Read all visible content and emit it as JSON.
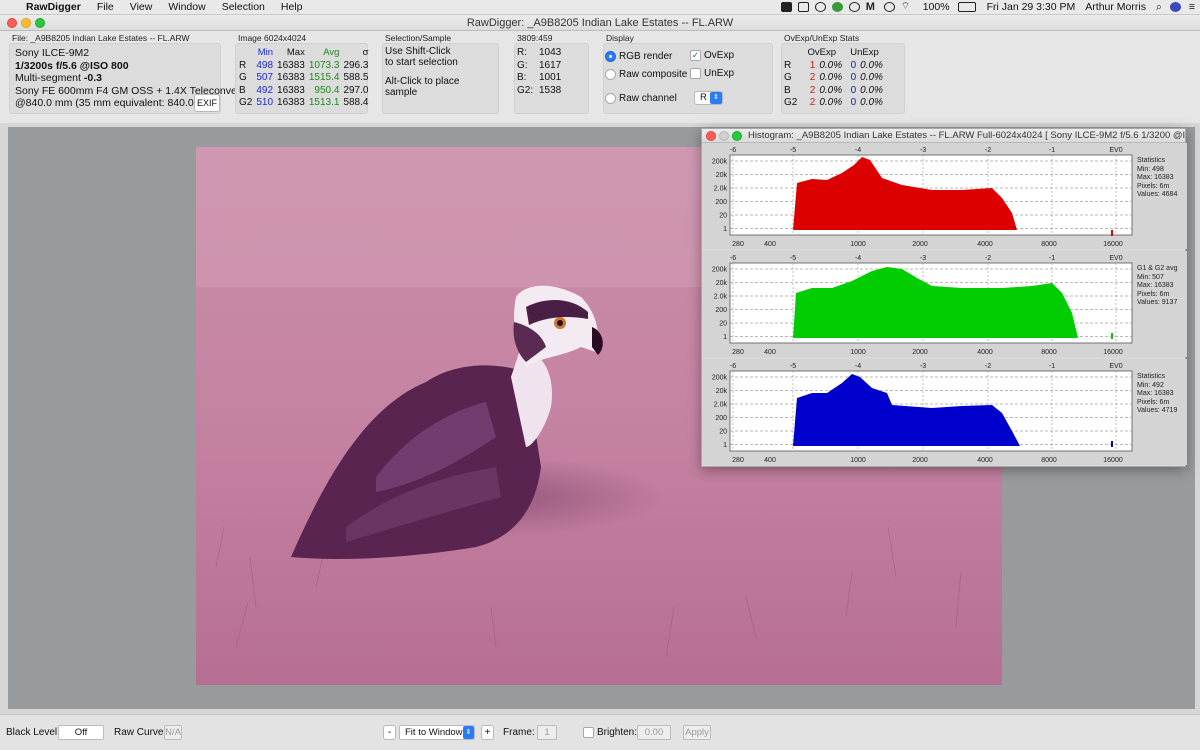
{
  "menubar": {
    "app": "RawDigger",
    "items": [
      "File",
      "View",
      "Window",
      "Selection",
      "Help"
    ],
    "battery": "100%",
    "datetime": "Fri Jan 29  3:30 PM",
    "user": "Arthur Morris"
  },
  "window": {
    "title": "RawDigger: _A9B8205  Indian Lake Estates -- FL.ARW"
  },
  "file_panel": {
    "label": "File: _A9B8205  Indian Lake Estates -- FL.ARW",
    "camera": "Sony ILCE-9M2",
    "exposure": "1/3200s f/5.6 @ISO 800",
    "segment_prefix": "Multi-segment",
    "segment_value": "-0.3",
    "lens": "Sony FE 600mm F4 GM OSS + 1.4X Teleconverter",
    "focal": "@840.0 mm (35 mm equivalent: 840.0 mm)",
    "exif_button": "EXIF"
  },
  "image_stats": {
    "label": "Image 6024x4024",
    "headers": [
      "Min",
      "Max",
      "Avg",
      "σ"
    ],
    "rows": [
      {
        "ch": "R",
        "min": "498",
        "max": "16383",
        "avg": "1073.3",
        "sd": "296.3"
      },
      {
        "ch": "G",
        "min": "507",
        "max": "16383",
        "avg": "1515.4",
        "sd": "588.5"
      },
      {
        "ch": "B",
        "min": "492",
        "max": "16383",
        "avg": "950.4",
        "sd": "297.0"
      },
      {
        "ch": "G2",
        "min": "510",
        "max": "16383",
        "avg": "1513.1",
        "sd": "588.4"
      }
    ]
  },
  "selection": {
    "label": "Selection/Sample",
    "line1": "Use Shift-Click",
    "line2": "to start selection",
    "line3": "Alt-Click to place",
    "line4": "sample"
  },
  "sample": {
    "label": "3809:459",
    "rows": [
      {
        "ch": "R:",
        "val": "1043"
      },
      {
        "ch": "G:",
        "val": "1617"
      },
      {
        "ch": "B:",
        "val": "1001"
      },
      {
        "ch": "G2:",
        "val": "1538"
      }
    ]
  },
  "display": {
    "label": "Display",
    "rgb_render": "RGB render",
    "raw_composite": "Raw composite",
    "raw_channel": "Raw channel",
    "ovexp": "OvExp",
    "unexp": "UnExp",
    "channel_value": "R"
  },
  "exposure_stats": {
    "label": "OvExp/UnExp Stats",
    "headers": [
      "OvExp",
      "UnExp"
    ],
    "rows": [
      {
        "ch": "R",
        "ov": "1",
        "ovp": "0.0%",
        "un": "0",
        "unp": "0.0%"
      },
      {
        "ch": "G",
        "ov": "2",
        "ovp": "0.0%",
        "un": "0",
        "unp": "0.0%"
      },
      {
        "ch": "B",
        "ov": "2",
        "ovp": "0.0%",
        "un": "0",
        "unp": "0.0%"
      },
      {
        "ch": "G2",
        "ov": "2",
        "ovp": "0.0%",
        "un": "0",
        "unp": "0.0%"
      }
    ]
  },
  "histogram": {
    "title": "Histogram: _A9B8205  Indian Lake Estates -- FL.ARW Full-6024x4024 [ Sony ILCE-9M2 f/5.6 1/3200 @ISO 8...",
    "ev_labels": [
      "-6",
      "-5",
      "-4",
      "-3",
      "-2",
      "-1",
      "EV0"
    ],
    "y_labels": [
      "200k",
      "20k",
      "2.0k",
      "200",
      "20",
      "1"
    ],
    "x_labels": [
      "280",
      "400",
      "1000",
      "2000",
      "4000",
      "8000",
      "16000"
    ],
    "colors": {
      "red": "#dd0000",
      "green": "#00cc00",
      "blue": "#0000cc"
    },
    "panels": [
      {
        "y_labels": [
          "200k",
          "20k",
          "2.0k",
          "200",
          "20",
          "1"
        ],
        "side": [
          "Statistics",
          "Min: 498",
          "Max: 16383",
          "Pixels: 6m",
          "Values: 4684"
        ]
      },
      {
        "y_labels": [
          "200k",
          "20k",
          "2.0k",
          "200",
          "20",
          "1"
        ],
        "side": [
          "G1 & G2 avg",
          "Min: 507",
          "Max: 16383",
          "Pixels: 6m",
          "Values: 9137"
        ]
      },
      {
        "y_labels": [
          "200k",
          "20k",
          "2.0k",
          "200",
          "20",
          "1"
        ],
        "side": [
          "Statistics",
          "Min: 492",
          "Max: 16383",
          "Pixels: 6m",
          "Values: 4719"
        ]
      }
    ]
  },
  "bottom": {
    "black_level_label": "Black Level:",
    "black_level_value": "Off",
    "raw_curve_label": "Raw Curve:",
    "raw_curve_value": "N/A",
    "zoom_minus": "-",
    "zoom_value": "Fit to Window",
    "zoom_plus": "+",
    "frame_label": "Frame:",
    "frame_value": "1",
    "brighten_label": "Brighten:",
    "brighten_value": "0.00",
    "apply": "Apply"
  }
}
